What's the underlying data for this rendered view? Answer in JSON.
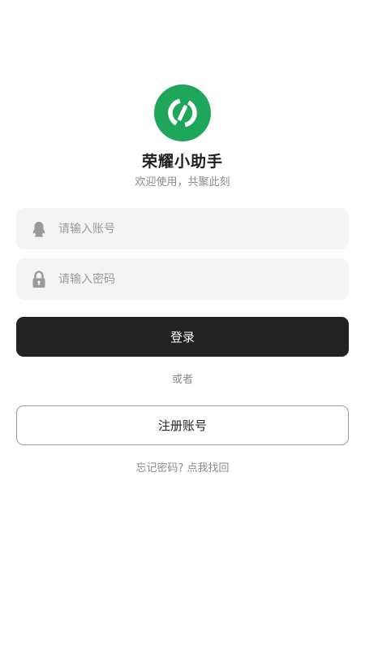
{
  "colors": {
    "brand_green": "#1ea75a",
    "primary_button": "#222222",
    "input_background": "#f4f4f4",
    "muted_text": "#8a8a8a"
  },
  "app": {
    "logo_icon": "brand-logo-icon",
    "name": "荣耀小助手",
    "tagline": "欢迎使用，共聚此刻"
  },
  "form": {
    "account": {
      "icon": "user-icon",
      "placeholder": "请输入账号",
      "value": ""
    },
    "password": {
      "icon": "lock-icon",
      "placeholder": "请输入密码",
      "value": ""
    }
  },
  "actions": {
    "login_label": "登录",
    "or_label": "或者",
    "register_label": "注册账号",
    "forgot_label": "忘记密码? 点我找回"
  }
}
